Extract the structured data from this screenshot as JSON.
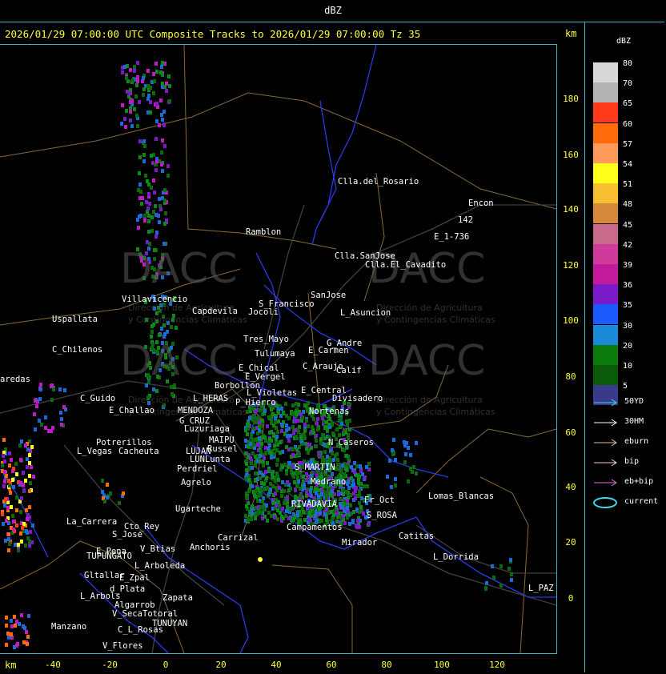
{
  "window": {
    "title": "dBZ"
  },
  "header": {
    "text": "2026/01/29 07:00:00 UTC Composite Tracks to 2026/01/29 07:00:00 Tz 35",
    "km_unit": "km"
  },
  "axes": {
    "y_ticks": [
      "180",
      "160",
      "140",
      "120",
      "100",
      "80",
      "60",
      "40",
      "20",
      "0"
    ],
    "x_ticks": [
      "-40",
      "-20",
      "0",
      "20",
      "40",
      "60",
      "80",
      "100",
      "120"
    ],
    "x_unit": "km"
  },
  "legend": {
    "title": "dBZ",
    "bins": [
      {
        "label": "80",
        "color": "#d8d8d8"
      },
      {
        "label": "70",
        "color": "#b4b4b4"
      },
      {
        "label": "65",
        "color": "#ff3a1a"
      },
      {
        "label": "60",
        "color": "#ff6a0a"
      },
      {
        "label": "57",
        "color": "#ff9a5a"
      },
      {
        "label": "54",
        "color": "#ffff1a"
      },
      {
        "label": "51",
        "color": "#f8c030"
      },
      {
        "label": "48",
        "color": "#d8883a"
      },
      {
        "label": "45",
        "color": "#c86a8a"
      },
      {
        "label": "42",
        "color": "#d03a9a"
      },
      {
        "label": "39",
        "color": "#c21a9a"
      },
      {
        "label": "36",
        "color": "#7a1ac8"
      },
      {
        "label": "35",
        "color": "#1a5aff"
      },
      {
        "label": "30",
        "color": "#1a8ad8"
      },
      {
        "label": "20",
        "color": "#0a7a0a"
      },
      {
        "label": "10",
        "color": "#0a5a0a"
      },
      {
        "label": "5",
        "color": "#3a3a8a"
      }
    ],
    "tracks": [
      {
        "label": "50YD",
        "color": "#3fd8e8"
      },
      {
        "label": "30HM",
        "color": "#ffffff"
      },
      {
        "label": "eburn",
        "color": "#e8c090"
      },
      {
        "label": "bip",
        "color": "#ffc8d8"
      },
      {
        "label": "eb+bip",
        "color": "#e070e0"
      },
      {
        "label": "current",
        "color": "#3fd8e8"
      }
    ]
  },
  "watermark": {
    "brand": "DACC",
    "line1": "Dirección de Agricultura",
    "line2": "y Contingencias Climáticas"
  },
  "places": [
    {
      "name": "Clla.del_Rosario"
    },
    {
      "name": "Encon"
    },
    {
      "name": "142"
    },
    {
      "name": "E_1-736"
    },
    {
      "name": "Ramblon"
    },
    {
      "name": "Clla.SanJose"
    },
    {
      "name": "Clla.El_Cavadito"
    },
    {
      "name": "Villavicencio"
    },
    {
      "name": "S_Francisco"
    },
    {
      "name": "Capdevila"
    },
    {
      "name": "Jocoli"
    },
    {
      "name": "SanJose"
    },
    {
      "name": "L_Asuncion"
    },
    {
      "name": "Uspallata"
    },
    {
      "name": "Tres_Mayo"
    },
    {
      "name": "G_Andre"
    },
    {
      "name": "E_Carmen"
    },
    {
      "name": "C_Chilenos"
    },
    {
      "name": "Tulumaya"
    },
    {
      "name": "C_Araujo"
    },
    {
      "name": "E_Chical"
    },
    {
      "name": "Calif"
    },
    {
      "name": "E_Vergel"
    },
    {
      "name": "aredas"
    },
    {
      "name": "Borbollon"
    },
    {
      "name": "L_Violetas"
    },
    {
      "name": "E_Central"
    },
    {
      "name": "Divisadero"
    },
    {
      "name": "C_Guido"
    },
    {
      "name": "L_HERAS"
    },
    {
      "name": "P_Hierro"
    },
    {
      "name": "Nortenas"
    },
    {
      "name": "E_Challao"
    },
    {
      "name": "MENDOZA"
    },
    {
      "name": "G_CRUZ"
    },
    {
      "name": "Luzuriaga"
    },
    {
      "name": "Potrerillos"
    },
    {
      "name": "MAIPU"
    },
    {
      "name": "Russel"
    },
    {
      "name": "N_Caseros"
    },
    {
      "name": "L_Vegas"
    },
    {
      "name": "Cacheuta"
    },
    {
      "name": "LUJAN"
    },
    {
      "name": "LUNLunta"
    },
    {
      "name": "Perdriel"
    },
    {
      "name": "S_MARTIN"
    },
    {
      "name": "Agrelo"
    },
    {
      "name": "Medrano"
    },
    {
      "name": "Ugarteche"
    },
    {
      "name": "RIVADAVIA"
    },
    {
      "name": "Lomas_Blancas"
    },
    {
      "name": "S_ROSA"
    },
    {
      "name": "La_Carrera"
    },
    {
      "name": "Cto_Rey"
    },
    {
      "name": "S_Jose"
    },
    {
      "name": "Carrizal"
    },
    {
      "name": "Campamentos"
    },
    {
      "name": "Catitas"
    },
    {
      "name": "E_Pena"
    },
    {
      "name": "V_Btias"
    },
    {
      "name": "Anchoris"
    },
    {
      "name": "Mirador"
    },
    {
      "name": "TUPUNGATO"
    },
    {
      "name": "L_Dorrida"
    },
    {
      "name": "L_Arboleda"
    },
    {
      "name": "Gltallar"
    },
    {
      "name": "E_Zpal"
    },
    {
      "name": "d_Plata"
    },
    {
      "name": "L_PAZ"
    },
    {
      "name": "L_Arbols"
    },
    {
      "name": "Zapata"
    },
    {
      "name": "Algarrob"
    },
    {
      "name": "V_Seca"
    },
    {
      "name": "Totoral"
    },
    {
      "name": "TUNUYAN"
    },
    {
      "name": "Manzano"
    },
    {
      "name": "C_L_Rosas"
    },
    {
      "name": "V_Flores"
    },
    {
      "name": "Fr_Oct"
    }
  ]
}
